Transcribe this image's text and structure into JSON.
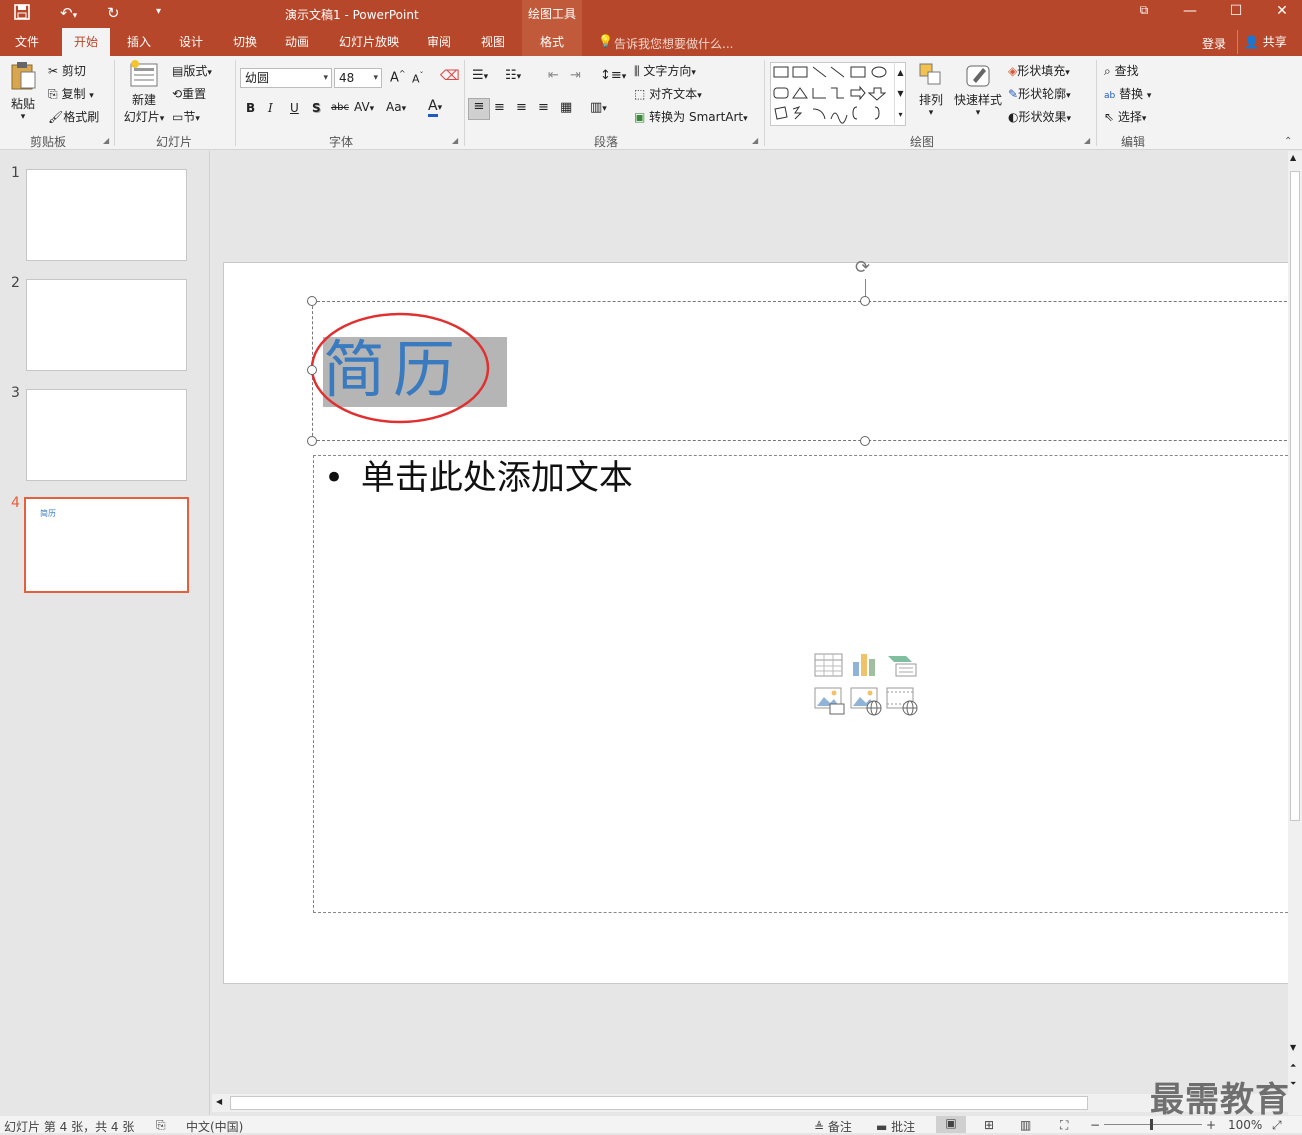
{
  "window": {
    "title": "演示文稿1 - PowerPoint",
    "context_header": "绘图工具"
  },
  "tabs": [
    "文件",
    "开始",
    "插入",
    "设计",
    "切换",
    "动画",
    "幻灯片放映",
    "审阅",
    "视图",
    "格式"
  ],
  "tell_me": "告诉我您想要做什么...",
  "account": {
    "signin": "登录",
    "share": "共享"
  },
  "ribbon": {
    "clipboard": {
      "paste": "粘贴",
      "cut": "剪切",
      "copy": "复制",
      "format_painter": "格式刷",
      "label": "剪贴板"
    },
    "slides": {
      "new_line1": "新建",
      "new_line2": "幻灯片",
      "layout": "版式",
      "reset": "重置",
      "section": "节",
      "label": "幻灯片"
    },
    "font": {
      "name": "幼圆",
      "size": "48",
      "label": "字体"
    },
    "paragraph": {
      "text_direction": "文字方向",
      "align_text": "对齐文本",
      "smartart": "转换为 SmartArt",
      "label": "段落"
    },
    "drawing": {
      "arrange": "排列",
      "quick_styles": "快速样式",
      "fill": "形状填充",
      "outline": "形状轮廓",
      "effects": "形状效果",
      "label": "绘图"
    },
    "editing": {
      "find": "查找",
      "replace": "替换",
      "select": "选择",
      "label": "编辑"
    }
  },
  "slides": [
    {
      "number": "1",
      "title": ""
    },
    {
      "number": "2",
      "title": ""
    },
    {
      "number": "3",
      "title": ""
    },
    {
      "number": "4",
      "title": "简历"
    }
  ],
  "current_slide": {
    "title": "简历",
    "body_placeholder": "单击此处添加文本"
  },
  "watermark": "最需教育",
  "status": {
    "slide_info": "幻灯片 第 4 张，共 4 张",
    "language": "中文(中国)",
    "notes": "备注",
    "comments": "批注",
    "zoom": "100%"
  },
  "colors": {
    "accent": "#b7472a",
    "selected_thumb": "#e55f3c",
    "title_text": "#3a7abf",
    "highlight": "#b5b5b5",
    "annotation": "#e03030"
  }
}
